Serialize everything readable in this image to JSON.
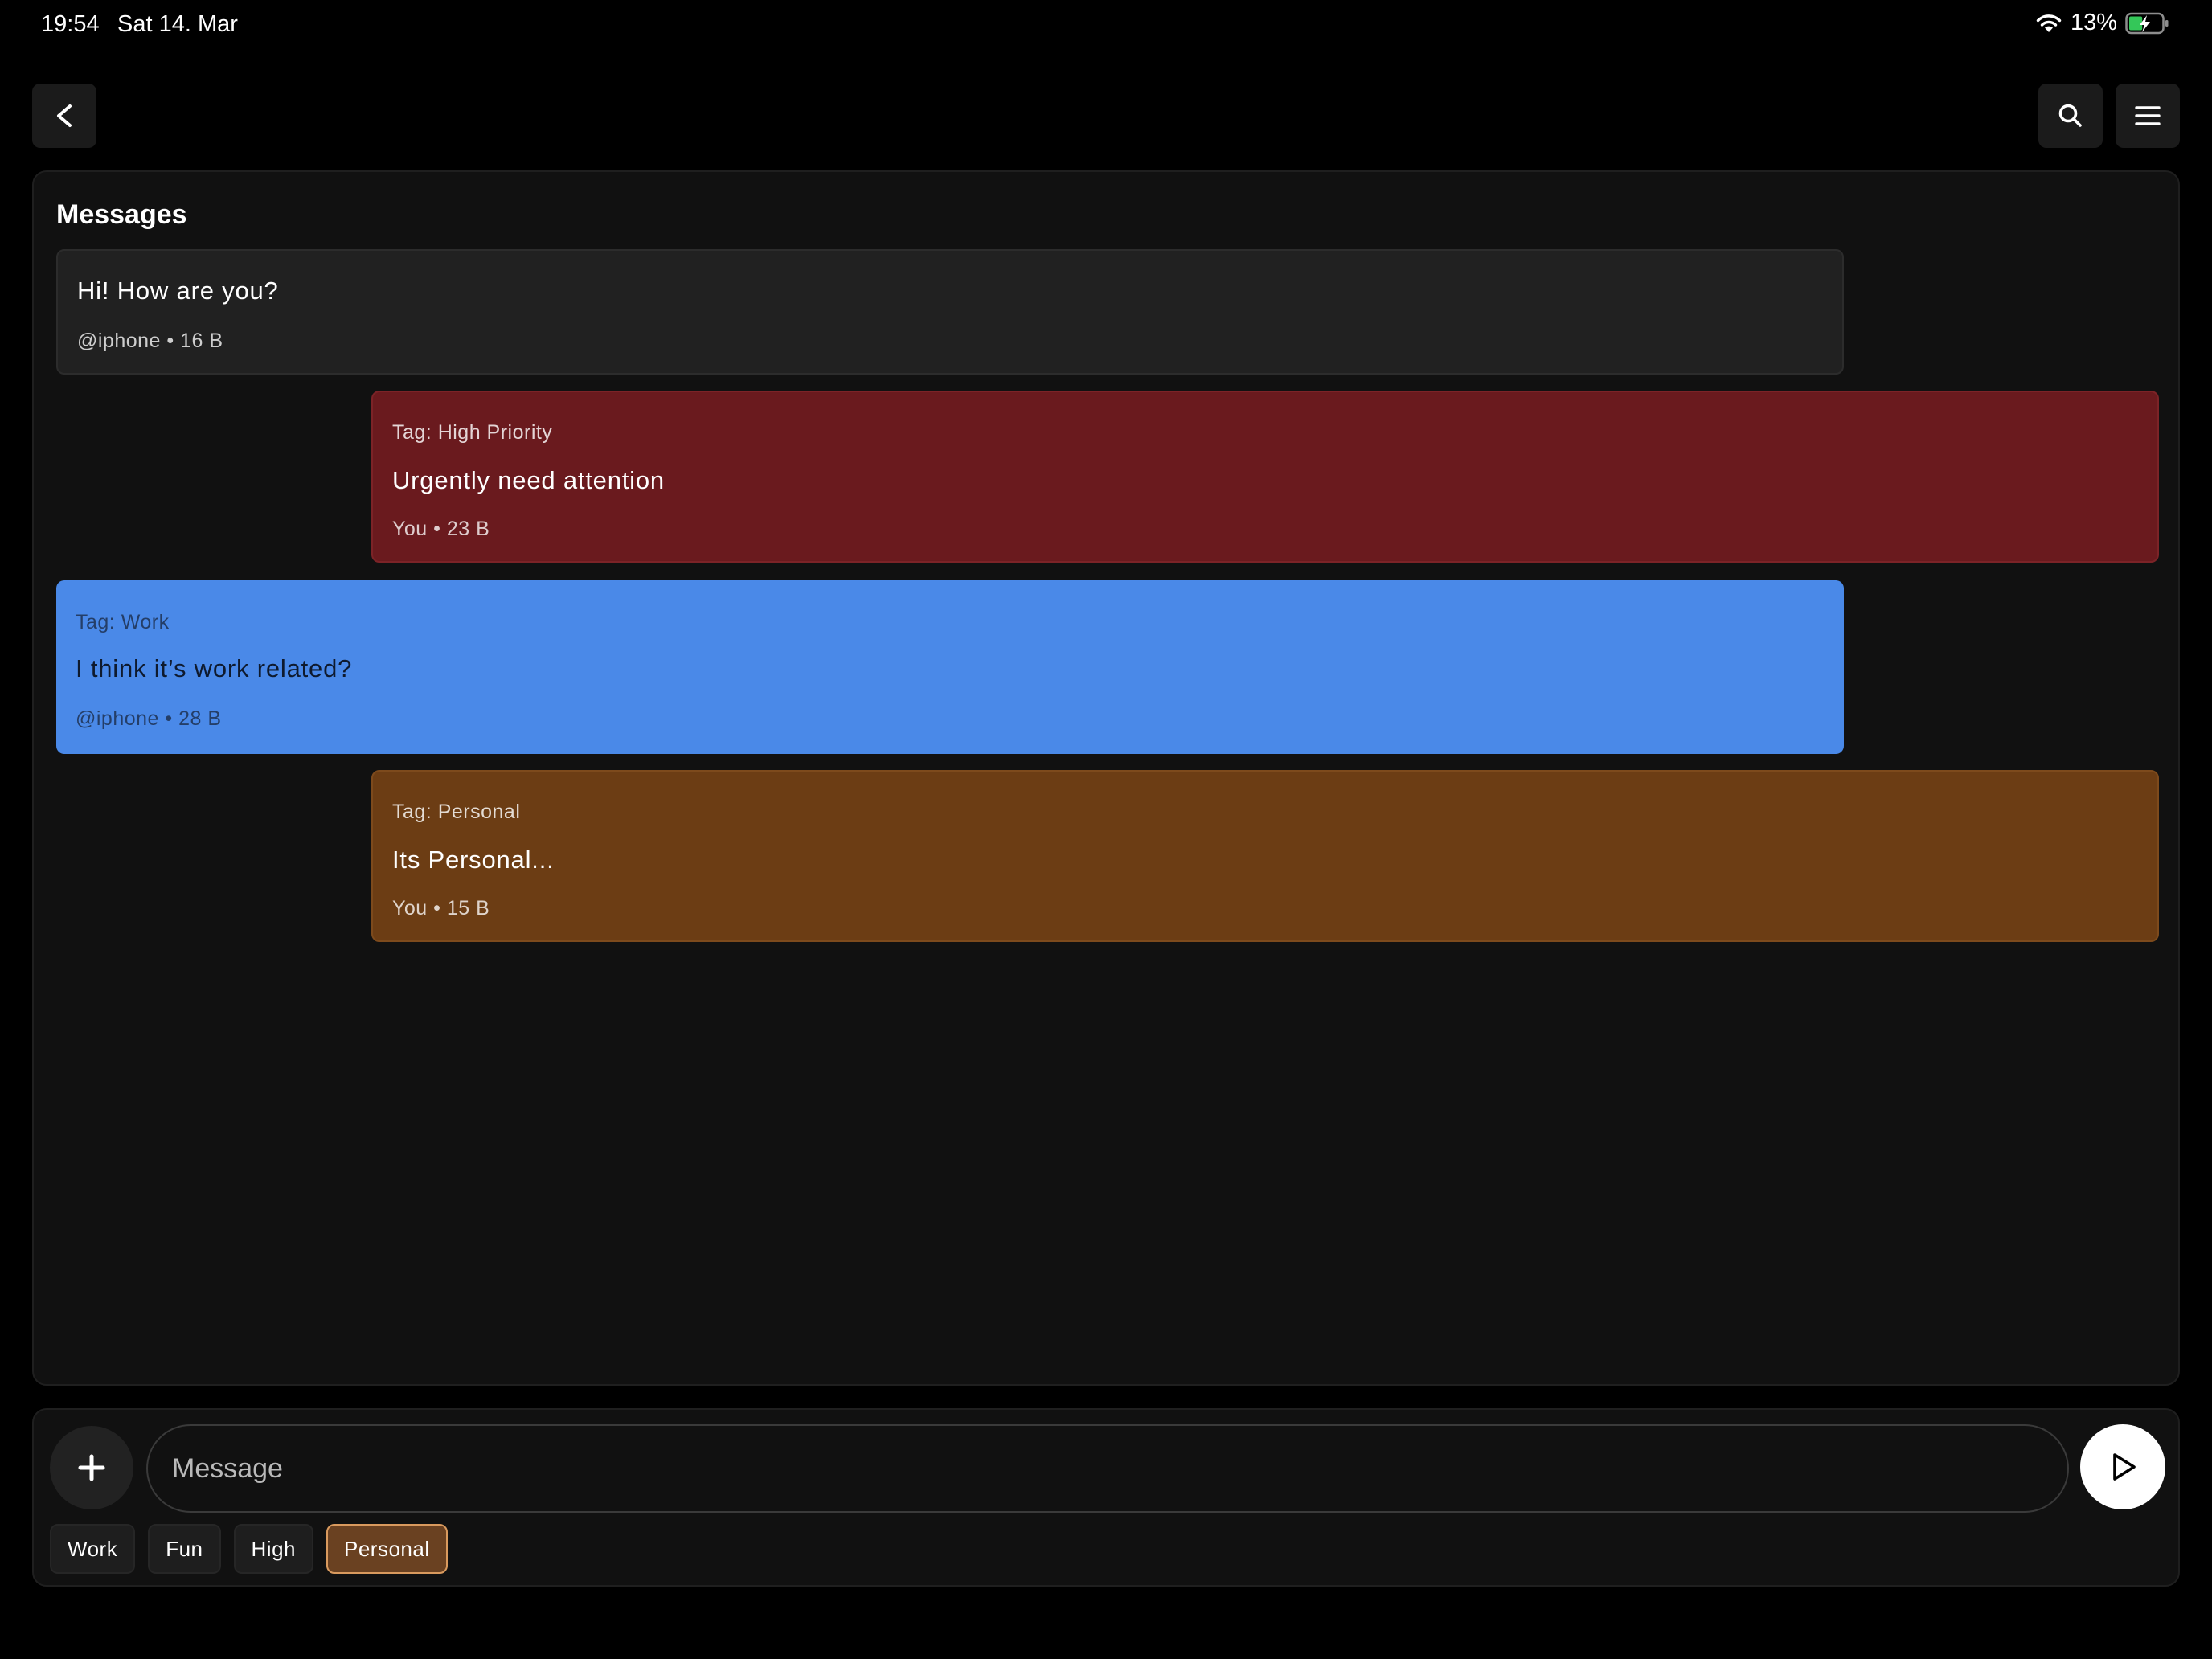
{
  "status_bar": {
    "time": "19:54",
    "date": "Sat 14. Mar",
    "battery_percent": "13%",
    "battery_level": 0.13,
    "wifi_icon": "wifi-icon",
    "battery_icon": "battery-charging-icon"
  },
  "nav": {
    "back_label": "<",
    "search_icon": "search-icon",
    "menu_icon": "menu-icon"
  },
  "panel": {
    "title": "Messages"
  },
  "messages": [
    {
      "tag": "",
      "body": "Hi! How are you?",
      "meta": "@iphone • 16 B",
      "color": "#212121"
    },
    {
      "tag": "Tag: High Priority",
      "body": "Urgently need attention",
      "meta": "You • 23 B",
      "color": "#6a1a1e"
    },
    {
      "tag": "Tag: Work",
      "body": "I think it’s work related?",
      "meta": "@iphone • 28 B",
      "color": "#4a89e8"
    },
    {
      "tag": "Tag: Personal",
      "body": "Its Personal...",
      "meta": "You • 15 B",
      "color": "#6c3d14"
    }
  ],
  "composer": {
    "add_icon": "plus-icon",
    "input_placeholder": "Message",
    "input_value": "",
    "send_icon": "send-icon"
  },
  "tag_chips": [
    {
      "label": "Work",
      "selected": false
    },
    {
      "label": "Fun",
      "selected": false
    },
    {
      "label": "High",
      "selected": false
    },
    {
      "label": "Personal",
      "selected": true
    }
  ],
  "colors": {
    "background": "#000000",
    "panel": "#111111",
    "high_priority": "#6a1a1e",
    "work": "#4a89e8",
    "personal": "#6c3d14",
    "chip_selected_border": "#d99a5e"
  }
}
